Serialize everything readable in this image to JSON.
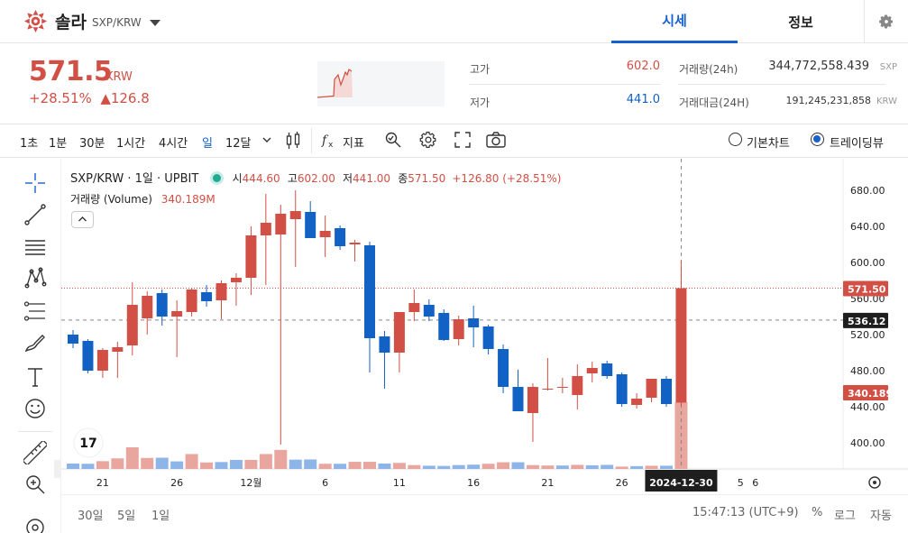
{
  "header": {
    "coin_name": "솔라",
    "pair": "SXP/KRW",
    "tabs": [
      "시세",
      "정보"
    ],
    "active_tab": "시세"
  },
  "ticker": {
    "price": "571.5",
    "unit": "KRW",
    "change_pct": "+28.51%",
    "change_abs": "▲126.8",
    "high_label": "고가",
    "high": "602.0",
    "low_label": "저가",
    "low": "441.0",
    "volume_label": "거래량(24h)",
    "volume": "344,772,558.439",
    "volume_unit": "SXP",
    "value_label": "거래대금(24H)",
    "value": "191,245,231,858",
    "value_unit": "KRW"
  },
  "toolbar": {
    "intervals": [
      "1초",
      "1분",
      "30분",
      "1시간",
      "4시간",
      "일",
      "12달"
    ],
    "active_interval": "일",
    "indicator_label": "지표",
    "view_basic": "기본차트",
    "view_tv": "트레이딩뷰",
    "active_view": "트레이딩뷰"
  },
  "legend": {
    "title": "SXP/KRW · 1일 · UPBIT",
    "open_label": "시",
    "open": "444.60",
    "high_label": "고",
    "high": "602.00",
    "low_label": "저",
    "low": "441.00",
    "close_label": "종",
    "close": "571.50",
    "change": "+126.80 (+28.51%)",
    "volume_label": "거래량 (Volume)",
    "volume_value": "340.189M"
  },
  "bottom": {
    "ranges": [
      "30일",
      "5일",
      "1일"
    ],
    "time": "15:47:13 (UTC+9)",
    "percent": "%",
    "log": "로그",
    "auto": "자동"
  },
  "colors": {
    "up": "#d24f45",
    "down": "#1261c4",
    "up_volume": "#e8a69f",
    "down_volume": "#8eb5e8",
    "accent": "#1761ce"
  },
  "chart_data": {
    "type": "candlestick",
    "symbol": "SXP/KRW",
    "interval": "1일",
    "exchange": "UPBIT",
    "ylim": [
      370,
      700
    ],
    "y_ticks": [
      400,
      440,
      480,
      520,
      560,
      600,
      640,
      680
    ],
    "y_tick_labels": [
      "400.00",
      "440.00",
      "480.00",
      "520.00",
      "560.00",
      "600.00",
      "640.00",
      "680.00"
    ],
    "x_tick_labels": [
      {
        "label": "21",
        "index": 2
      },
      {
        "label": "26",
        "index": 7
      },
      {
        "label": "12월",
        "index": 12
      },
      {
        "label": "6",
        "index": 17
      },
      {
        "label": "11",
        "index": 22
      },
      {
        "label": "16",
        "index": 27
      },
      {
        "label": "21",
        "index": 32
      },
      {
        "label": "26",
        "index": 37
      },
      {
        "label": "2024-12-30",
        "index": 41,
        "highlight": true
      },
      {
        "label": "5",
        "index": 45
      },
      {
        "label": "6",
        "index": 46
      }
    ],
    "price_line": {
      "value": 571.5,
      "label": "571.50"
    },
    "crosshair": {
      "value": 536.12,
      "label": "536.12",
      "index": 41
    },
    "volume_label": "340.189M",
    "candles": [
      {
        "o": 520,
        "h": 525,
        "l": 505,
        "c": 510
      },
      {
        "o": 513,
        "h": 515,
        "l": 477,
        "c": 480
      },
      {
        "o": 480,
        "h": 505,
        "l": 472,
        "c": 503
      },
      {
        "o": 501,
        "h": 512,
        "l": 472,
        "c": 506
      },
      {
        "o": 508,
        "h": 578,
        "l": 497,
        "c": 553
      },
      {
        "o": 538,
        "h": 568,
        "l": 520,
        "c": 563
      },
      {
        "o": 566,
        "h": 570,
        "l": 530,
        "c": 540
      },
      {
        "o": 540,
        "h": 558,
        "l": 495,
        "c": 546
      },
      {
        "o": 545,
        "h": 572,
        "l": 540,
        "c": 570
      },
      {
        "o": 567,
        "h": 575,
        "l": 551,
        "c": 557
      },
      {
        "o": 558,
        "h": 580,
        "l": 537,
        "c": 577
      },
      {
        "o": 578,
        "h": 588,
        "l": 552,
        "c": 583
      },
      {
        "o": 583,
        "h": 640,
        "l": 564,
        "c": 630
      },
      {
        "o": 630,
        "h": 676,
        "l": 575,
        "c": 644
      },
      {
        "o": 631,
        "h": 664,
        "l": 398,
        "c": 654
      },
      {
        "o": 648,
        "h": 680,
        "l": 595,
        "c": 657
      },
      {
        "o": 656,
        "h": 668,
        "l": 631,
        "c": 627
      },
      {
        "o": 628,
        "h": 652,
        "l": 606,
        "c": 635
      },
      {
        "o": 638,
        "h": 641,
        "l": 614,
        "c": 618
      },
      {
        "o": 620,
        "h": 625,
        "l": 601,
        "c": 622
      },
      {
        "o": 619,
        "h": 623,
        "l": 478,
        "c": 516
      },
      {
        "o": 518,
        "h": 524,
        "l": 460,
        "c": 500
      },
      {
        "o": 500,
        "h": 522,
        "l": 478,
        "c": 545
      },
      {
        "o": 545,
        "h": 570,
        "l": 535,
        "c": 555
      },
      {
        "o": 553,
        "h": 559,
        "l": 535,
        "c": 540
      },
      {
        "o": 544,
        "h": 548,
        "l": 513,
        "c": 514
      },
      {
        "o": 515,
        "h": 541,
        "l": 508,
        "c": 537
      },
      {
        "o": 538,
        "h": 552,
        "l": 506,
        "c": 528
      },
      {
        "o": 529,
        "h": 531,
        "l": 498,
        "c": 504
      },
      {
        "o": 504,
        "h": 509,
        "l": 455,
        "c": 462
      },
      {
        "o": 462,
        "h": 481,
        "l": 436,
        "c": 435
      },
      {
        "o": 433,
        "h": 466,
        "l": 401,
        "c": 462
      },
      {
        "o": 460,
        "h": 494,
        "l": 458,
        "c": 460
      },
      {
        "o": 462,
        "h": 472,
        "l": 455,
        "c": 462
      },
      {
        "o": 453,
        "h": 487,
        "l": 437,
        "c": 474
      },
      {
        "o": 477,
        "h": 490,
        "l": 467,
        "c": 483
      },
      {
        "o": 488,
        "h": 491,
        "l": 471,
        "c": 474
      },
      {
        "o": 476,
        "h": 478,
        "l": 440,
        "c": 443
      },
      {
        "o": 442,
        "h": 455,
        "l": 438,
        "c": 449
      },
      {
        "o": 450,
        "h": 471,
        "l": 445,
        "c": 471
      },
      {
        "o": 471,
        "h": 474,
        "l": 440,
        "c": 443
      },
      {
        "o": 444.6,
        "h": 602,
        "l": 441,
        "c": 571.5
      }
    ],
    "volumes": [
      {
        "v": 0.25,
        "up": false
      },
      {
        "v": 0.24,
        "up": false
      },
      {
        "v": 0.36,
        "up": true
      },
      {
        "v": 0.49,
        "up": true
      },
      {
        "v": 1.0,
        "up": true
      },
      {
        "v": 0.51,
        "up": true
      },
      {
        "v": 0.52,
        "up": false
      },
      {
        "v": 0.35,
        "up": false
      },
      {
        "v": 0.69,
        "up": true
      },
      {
        "v": 0.3,
        "up": true
      },
      {
        "v": 0.32,
        "up": false
      },
      {
        "v": 0.42,
        "up": false
      },
      {
        "v": 0.42,
        "up": true
      },
      {
        "v": 0.69,
        "up": true
      },
      {
        "v": 0.88,
        "up": true
      },
      {
        "v": 0.43,
        "up": false
      },
      {
        "v": 0.44,
        "up": false
      },
      {
        "v": 0.24,
        "up": true
      },
      {
        "v": 0.24,
        "up": false
      },
      {
        "v": 0.33,
        "up": true
      },
      {
        "v": 0.33,
        "up": true
      },
      {
        "v": 0.25,
        "up": false
      },
      {
        "v": 0.28,
        "up": true
      },
      {
        "v": 0.18,
        "up": true
      },
      {
        "v": 0.15,
        "up": false
      },
      {
        "v": 0.14,
        "up": false
      },
      {
        "v": 0.18,
        "up": false
      },
      {
        "v": 0.2,
        "up": false
      },
      {
        "v": 0.24,
        "up": true
      },
      {
        "v": 0.31,
        "up": true
      },
      {
        "v": 0.31,
        "up": false
      },
      {
        "v": 0.18,
        "up": true
      },
      {
        "v": 0.16,
        "up": true
      },
      {
        "v": 0.16,
        "up": false
      },
      {
        "v": 0.19,
        "up": true
      },
      {
        "v": 0.17,
        "up": false
      },
      {
        "v": 0.19,
        "up": false
      },
      {
        "v": 0.11,
        "up": true
      },
      {
        "v": 0.13,
        "up": false
      },
      {
        "v": 0.15,
        "up": true
      },
      {
        "v": 0.15,
        "up": false
      },
      {
        "v": 4.5,
        "up": true
      }
    ]
  }
}
